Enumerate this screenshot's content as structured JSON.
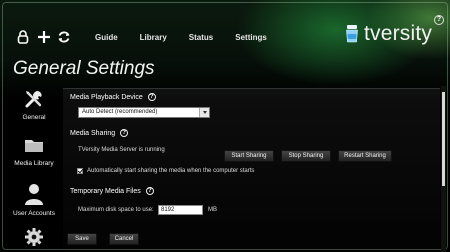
{
  "toolbar": {
    "nav": [
      "Guide",
      "Library",
      "Status",
      "Settings"
    ],
    "icons": [
      "lock-icon",
      "add-icon",
      "refresh-icon"
    ]
  },
  "brand": {
    "name": "tversity"
  },
  "help_icon": "?",
  "page_title": "General Settings",
  "sidebar": {
    "items": [
      {
        "label": "General",
        "icon": "tools-icon"
      },
      {
        "label": "Media Library",
        "icon": "folder-icon"
      },
      {
        "label": "User Accounts",
        "icon": "user-icon"
      },
      {
        "label": "",
        "icon": "gear-icon"
      }
    ]
  },
  "sections": {
    "playback": {
      "title": "Media Playback Device",
      "selected": "Auto Detect (recommended)"
    },
    "sharing": {
      "title": "Media Sharing",
      "status": "TVersity Media Server is running",
      "start": "Start Sharing",
      "stop": "Stop Sharing",
      "restart": "Restart Sharing",
      "auto_start_label": "Automatically start sharing the media when the computer starts",
      "auto_start_checked": true
    },
    "temp": {
      "title": "Temporary Media Files",
      "disk_label": "Maximum disk space to use:",
      "disk_value": "8192",
      "unit": "MB"
    }
  },
  "actions": {
    "save": "Save",
    "cancel": "Cancel"
  }
}
